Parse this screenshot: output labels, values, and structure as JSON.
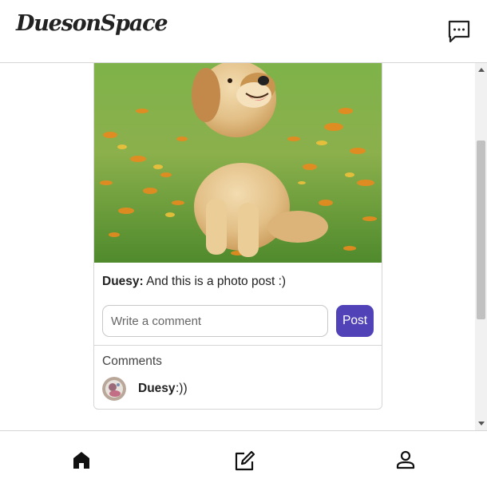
{
  "header": {
    "logo_text": "DuesonSpace",
    "messages_icon": "chat-bubble-ellipsis-icon"
  },
  "post": {
    "image_description_icon": "golden-retriever-puppy-photo",
    "author": "Duesy:",
    "caption": " And this is a photo post :)",
    "comment_placeholder": "Write a comment",
    "comment_value": "",
    "post_button_label": "Post",
    "comments_heading": "Comments",
    "comments": [
      {
        "author": "Duesy",
        "text": ":))"
      }
    ]
  },
  "bottom_nav": {
    "items": [
      {
        "icon": "home-icon",
        "active": true
      },
      {
        "icon": "edit-icon",
        "active": false
      },
      {
        "icon": "user-icon",
        "active": false
      }
    ]
  },
  "colors": {
    "accent": "#5142b8",
    "border": "#d6d6d6"
  }
}
